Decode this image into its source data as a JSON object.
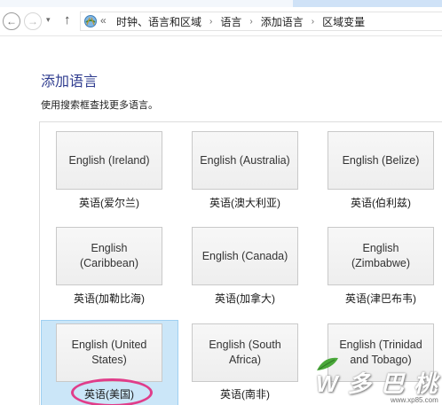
{
  "navigation": {
    "back_glyph": "←",
    "forward_glyph": "→",
    "recent_glyph": "▾",
    "up_glyph": "↑",
    "overflow_glyph": "«",
    "breadcrumbs": [
      "时钟、语言和区域",
      "语言",
      "添加语言",
      "区域变量"
    ],
    "separator": "›"
  },
  "page": {
    "title": "添加语言",
    "instruction": "使用搜索框查找更多语言。"
  },
  "languages": [
    {
      "tile": "English (Ireland)",
      "caption": "英语(爱尔兰)"
    },
    {
      "tile": "English (Australia)",
      "caption": "英语(澳大利亚)"
    },
    {
      "tile": "English (Belize)",
      "caption": "英语(伯利兹)"
    },
    {
      "tile": "English (Caribbean)",
      "caption": "英语(加勒比海)"
    },
    {
      "tile": "English (Canada)",
      "caption": "英语(加拿大)"
    },
    {
      "tile": "English (Zimbabwe)",
      "caption": "英语(津巴布韦)"
    },
    {
      "tile": "English (United States)",
      "caption": "英语(美国)",
      "selected": true
    },
    {
      "tile": "English (South Africa)",
      "caption": "英语(南非)"
    },
    {
      "tile": "English (Trinidad and Tobago)",
      "caption": ""
    }
  ],
  "watermark": {
    "brand": "W 多 巴 桃",
    "url": "www.xp85.com",
    "colors": {
      "leaf": "#4aa83a",
      "circle": "#e03d8a"
    }
  }
}
